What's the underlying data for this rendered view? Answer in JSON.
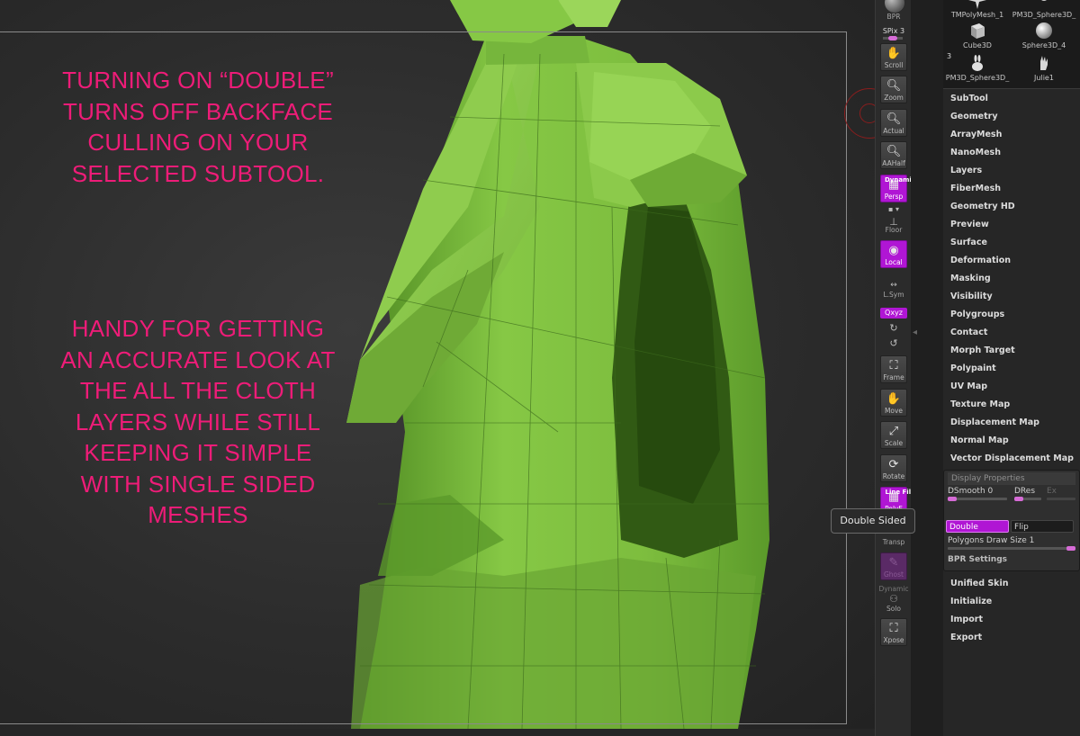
{
  "annotations": {
    "note_1": [
      "TURNING ON “DOUBLE”",
      "TURNS OFF BACKFACE",
      "CULLING ON YOUR",
      "SELECTED SUBTOOL."
    ],
    "note_2": [
      "HANDY FOR GETTING",
      "AN ACCURATE LOOK AT",
      "THE ALL THE CLOTH",
      "LAYERS WHILE STILL",
      "KEEPING IT SIMPLE",
      "WITH SINGLE SIDED",
      "MESHES"
    ]
  },
  "colors": {
    "annotation_text": "#ee1c78",
    "mesh_green": "#7cc242",
    "active_button": "#b016d4",
    "slider_knob": "#d66bd6"
  },
  "shelf": {
    "bpr": "BPR",
    "spix": "SPix 3",
    "scroll": "Scroll",
    "zoom": "Zoom",
    "actual": "Actual",
    "aahalf": "AAHalf",
    "dynamic_top": "Dynamic",
    "persp": "Persp",
    "floor": "Floor",
    "local": "Local",
    "lsym": "L.Sym",
    "xyz": "Qxyz",
    "frame": "Frame",
    "move": "Move",
    "scale": "Scale",
    "rotate": "Rotate",
    "line_fill": "Line Fill",
    "polyf": "PolyF",
    "transp": "Transp",
    "ghost": "Ghost",
    "dynamic_bottom": "Dynamic",
    "solo": "Solo",
    "xpose": "Xpose"
  },
  "tools": {
    "thumb_top_left": "TMPolyMesh_1",
    "thumb_top_right": "PM3D_Sphere3D_",
    "cube": "Cube3D",
    "sphere": "Sphere3D_4",
    "pm3d": "PM3D_Sphere3D_",
    "julie": "Julie1",
    "count": "3"
  },
  "menu": [
    "SubTool",
    "Geometry",
    "ArrayMesh",
    "NanoMesh",
    "Layers",
    "FiberMesh",
    "Geometry HD",
    "Preview",
    "Surface",
    "Deformation",
    "Masking",
    "Visibility",
    "Polygroups",
    "Contact",
    "Morph Target",
    "Polypaint",
    "UV Map",
    "Texture Map",
    "Displacement Map",
    "Normal Map",
    "Vector Displacement Map"
  ],
  "display_properties": {
    "title": "Display Properties",
    "dsmooth": "DSmooth 0",
    "dres": "DRes",
    "ex": "Ex",
    "double": "Double",
    "flip": "Flip",
    "polygons_draw_size": "Polygons Draw Size 1",
    "bpr_settings": "BPR Settings"
  },
  "menu_lower": [
    "Unified Skin",
    "Initialize",
    "Import",
    "Export"
  ],
  "tooltip": "Double Sided"
}
